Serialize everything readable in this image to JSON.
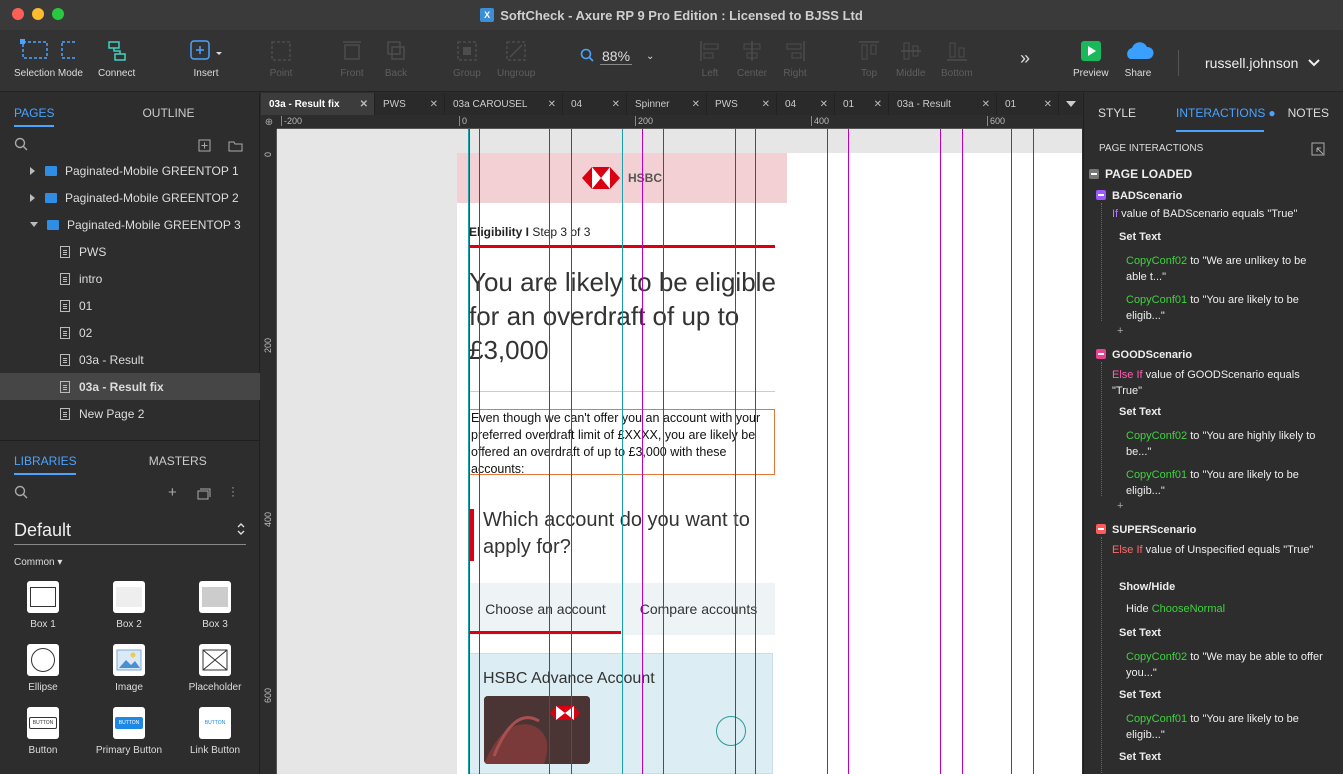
{
  "window": {
    "title": "SoftCheck - Axure RP 9 Pro Edition : Licensed to BJSS Ltd",
    "traffic_lights": [
      "#ff5f57",
      "#febc2e",
      "#28c840"
    ]
  },
  "toolbar": {
    "selection_mode": "Selection Mode",
    "connect": "Connect",
    "insert": "Insert",
    "point": "Point",
    "front": "Front",
    "back": "Back",
    "group": "Group",
    "ungroup": "Ungroup",
    "zoom": "88%",
    "left": "Left",
    "center": "Center",
    "right": "Right",
    "top": "Top",
    "middle": "Middle",
    "bottom": "Bottom",
    "more": "»",
    "preview": "Preview",
    "share": "Share",
    "user": "russell.johnson"
  },
  "left_panel": {
    "tabs": [
      "PAGES",
      "OUTLINE"
    ],
    "pages": [
      {
        "label": "Paginated-Mobile GREENTOP 1",
        "type": "folder",
        "state": "collapsed"
      },
      {
        "label": "Paginated-Mobile GREENTOP 2",
        "type": "folder",
        "state": "collapsed"
      },
      {
        "label": "Paginated-Mobile GREENTOP 3",
        "type": "folder",
        "state": "expanded"
      },
      {
        "label": "PWS",
        "type": "page"
      },
      {
        "label": "intro",
        "type": "page"
      },
      {
        "label": "01",
        "type": "page"
      },
      {
        "label": "02",
        "type": "page"
      },
      {
        "label": "03a - Result",
        "type": "page"
      },
      {
        "label": "03a - Result fix",
        "type": "page",
        "selected": true
      },
      {
        "label": "New Page 2",
        "type": "page"
      }
    ],
    "lib_tabs": [
      "LIBRARIES",
      "MASTERS"
    ],
    "library": "Default",
    "category": "Common ▾",
    "widgets": [
      "Box 1",
      "Box 2",
      "Box 3",
      "Ellipse",
      "Image",
      "Placeholder",
      "Button",
      "Primary Button",
      "Link Button"
    ],
    "button_text": "BUTTON"
  },
  "doc_tabs": [
    "03a - Result fix",
    "PWS",
    "03a CAROUSEL",
    "04",
    "Spinner",
    "PWS",
    "04",
    "01",
    "03a - Result",
    "01"
  ],
  "rulers": {
    "h": [
      "-200",
      "0",
      "200",
      "400",
      "600"
    ],
    "v": [
      "0",
      "200",
      "400",
      "600"
    ]
  },
  "canvas": {
    "logo_text": "HSBC",
    "step_bold": "Eligibility I",
    "step_rest": " Step 3 of 3",
    "headline": "You are likely to be eligible for an overdraft of up to £3,000",
    "paragraph": "Even though we can't offer you an account with your preferred overdraft  limit of £XXXX, you are likely be offered an overdraft of up to £3,000 with these accounts:",
    "question": "Which account do you want to apply for?",
    "tab_choose": "Choose an account",
    "tab_compare": "Compare accounts",
    "card_title": "HSBC Advance Account",
    "accent": "#db0011"
  },
  "right_panel": {
    "tabs": [
      "STYLE",
      "INTERACTIONS",
      "NOTES"
    ],
    "section": "PAGE INTERACTIONS",
    "event": "PAGE LOADED",
    "cases": [
      {
        "name": "BADScenario",
        "cond_kw": "If",
        "cond": " value of BADScenario equals \"True\"",
        "actions": [
          {
            "title": "Set Text",
            "lines": [
              {
                "target": "CopyConf02",
                "text": " to \"We are unlikey to be able t...\""
              },
              {
                "target": "CopyConf01",
                "text": " to \"You are likely to be eligib...\""
              }
            ]
          }
        ]
      },
      {
        "name": "GOODScenario",
        "cond_kw": "Else If",
        "cond": " value of GOODScenario equals \"True\"",
        "actions": [
          {
            "title": "Set Text",
            "lines": [
              {
                "target": "CopyConf02",
                "text": " to \"You are highly likely to be...\""
              },
              {
                "target": "CopyConf01",
                "text": " to \"You are likely to be eligib...\""
              }
            ]
          }
        ]
      },
      {
        "name": "SUPERScenario",
        "cond_kw": "Else If",
        "cond": " value of Unspecified equals \"True\"",
        "actions": [
          {
            "title": "Show/Hide",
            "lines": [
              {
                "prefix": "Hide ",
                "target": "ChooseNormal",
                "text": ""
              }
            ]
          },
          {
            "title": "Set Text",
            "lines": [
              {
                "target": "CopyConf02",
                "text": " to \"We may be able to offer you...\""
              }
            ]
          },
          {
            "title": "Set Text",
            "lines": [
              {
                "target": "CopyConf01",
                "text": " to \"You are likely to be eligib...\""
              }
            ]
          },
          {
            "title": "Set Text",
            "lines": []
          }
        ]
      }
    ],
    "plus": "+"
  }
}
